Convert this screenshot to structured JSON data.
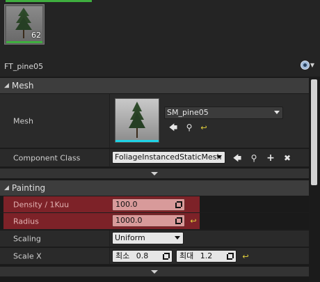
{
  "foliage_list": {
    "thumbnail_count": "62",
    "asset_name": "FT_pine05"
  },
  "categories": {
    "mesh": "Mesh",
    "painting": "Painting"
  },
  "mesh_section": {
    "mesh_label": "Mesh",
    "mesh_value": "SM_pine05",
    "component_class_label": "Component Class",
    "component_class_value": "FoliageInstancedStaticMesh"
  },
  "painting_section": {
    "density_label": "Density / 1Kuu",
    "density_value": "100.0",
    "radius_label": "Radius",
    "radius_value": "1000.0",
    "scaling_label": "Scaling",
    "scaling_value": "Uniform",
    "scale_x_label": "Scale X",
    "scale_x_min_prefix": "최소",
    "scale_x_min_value": "0.8",
    "scale_x_max_prefix": "최대",
    "scale_x_max_value": "1.2"
  },
  "colors": {
    "highlight_red": "#7d2228",
    "selection_green": "#3fae3f",
    "thumbnail_cyan": "#1fd3e6",
    "reset_yellow": "#e5d23b"
  }
}
